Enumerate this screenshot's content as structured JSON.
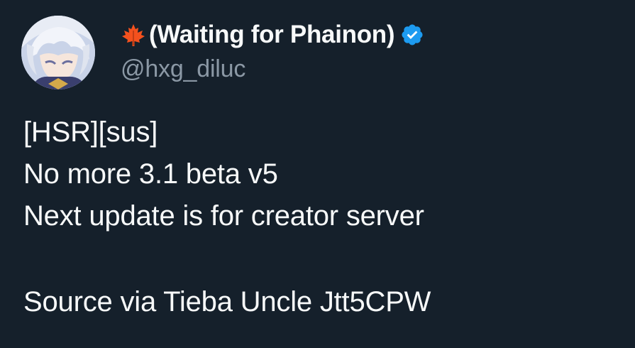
{
  "author": {
    "name_prefix_icon": "maple-leaf-icon",
    "display_name": "(Waiting for Phainon)",
    "verified_icon": "verified-badge-icon",
    "handle": "@hxg_diluc"
  },
  "tweet": {
    "lines": [
      "[HSR][sus]",
      "No more 3.1 beta v5",
      "Next update is for creator server",
      "",
      "Source via Tieba Uncle Jtt5CPW"
    ]
  },
  "colors": {
    "background": "#15202b",
    "text_primary": "#f7f9f9",
    "text_secondary": "#8b98a5",
    "verified_blue": "#1d9bf0",
    "leaf_orange": "#f4511e"
  }
}
